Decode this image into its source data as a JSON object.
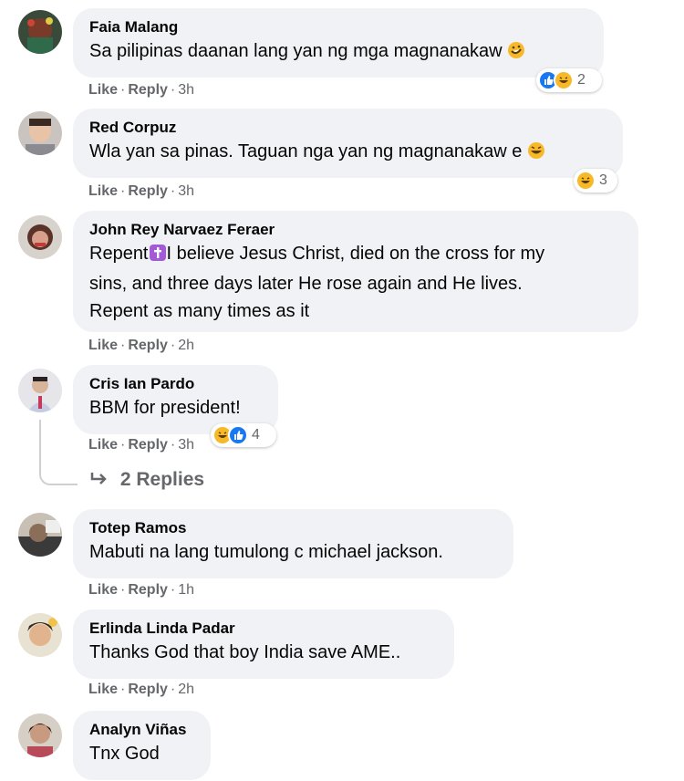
{
  "actions": {
    "like": "Like",
    "reply": "Reply",
    "separator": "·"
  },
  "comments": [
    {
      "name": "Faia Malang",
      "text": "Sa pilipinas daanan lang yan ng mga magnanakaw",
      "time": "3h",
      "reaction_count": "2",
      "reactions": [
        "like-icon",
        "haha-icon"
      ],
      "inline_emoji": "rofl-emoji"
    },
    {
      "name": "Red Corpuz",
      "text": "Wla yan sa pinas. Taguan nga yan ng magnanakaw e",
      "time": "3h",
      "reaction_count": "3",
      "reactions": [
        "haha-icon"
      ],
      "inline_emoji": "laughing-emoji"
    },
    {
      "name": "John Rey Narvaez Feraer",
      "text_prefix": "Repent",
      "text_line1": "I believe Jesus Christ, died on the cross for my",
      "text_line2": "sins, and three days later He rose again and He lives.",
      "text_line3": "Repent as many times as it",
      "time": "2h",
      "inline_emoji": "latin-cross-emoji"
    },
    {
      "name": "Cris Ian Pardo",
      "text": "BBM for president!",
      "time": "3h",
      "reaction_count": "4",
      "reactions": [
        "haha-icon",
        "like-icon"
      ]
    },
    {
      "name": "Totep Ramos",
      "text": "Mabuti na lang tumulong c michael jackson.",
      "time": "1h"
    },
    {
      "name": "Erlinda Linda Padar",
      "text": "Thanks God that boy India save AME..",
      "time": "2h"
    },
    {
      "name": "Analyn Viñas",
      "text": "Tnx God"
    }
  ],
  "replies_link": {
    "label": "2 Replies",
    "icon": "reply-arrow-icon"
  },
  "colors": {
    "bubble": "#f0f2f5",
    "meta": "#65676b",
    "like": "#1877f2",
    "haha": "#f7b928"
  }
}
